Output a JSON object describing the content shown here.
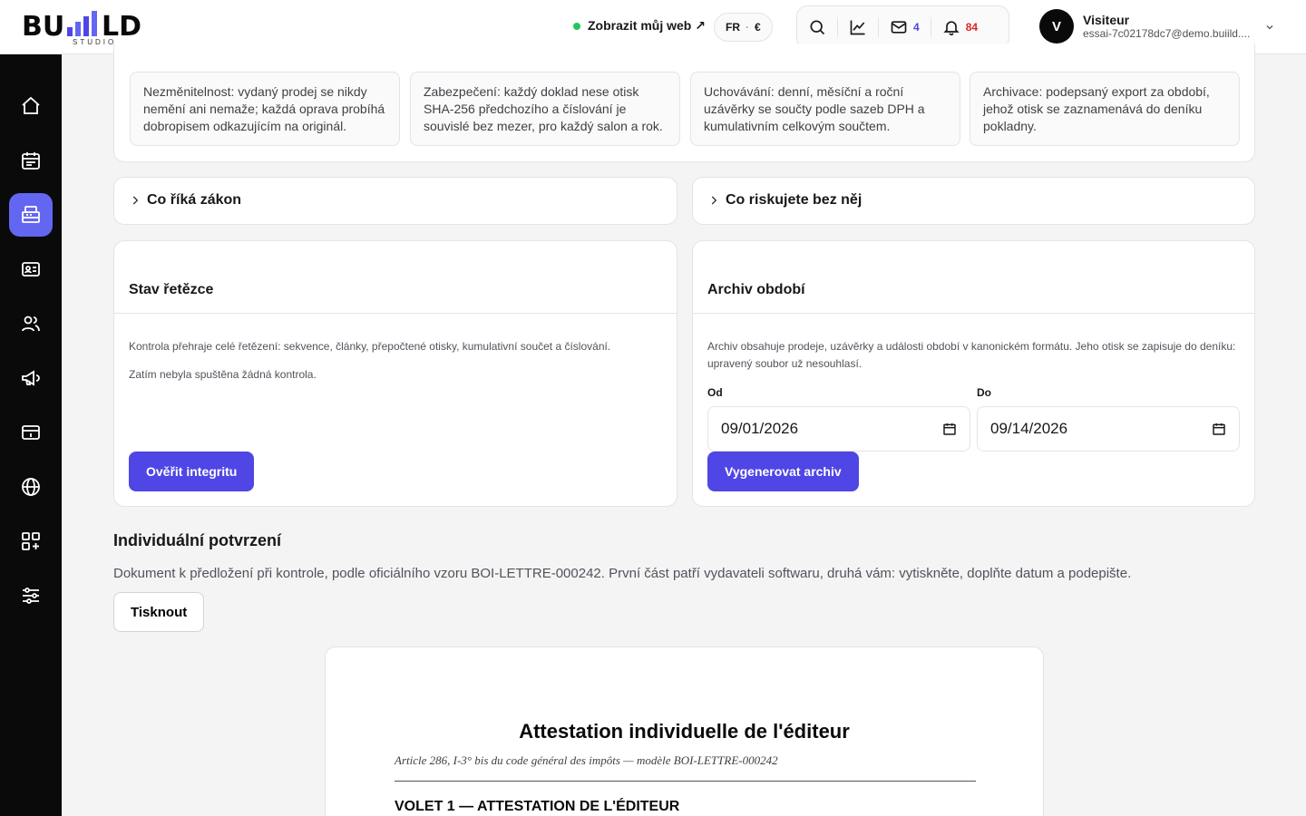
{
  "header": {
    "logo_text": "BUILD",
    "logo_sub": "STUDIO",
    "view_site_label": "Zobrazit můj web ↗",
    "lang": "FR",
    "currency": "€",
    "mail_count": "4",
    "notif_count": "84",
    "user": {
      "initial": "V",
      "name": "Visiteur",
      "email": "essai-7c02178dc7@demo.buiild...."
    }
  },
  "sidebar": {
    "items": [
      {
        "icon": "home-icon"
      },
      {
        "icon": "calendar-icon"
      },
      {
        "icon": "cash-register-icon",
        "active": true
      },
      {
        "icon": "contact-card-icon"
      },
      {
        "icon": "users-icon"
      },
      {
        "icon": "megaphone-icon"
      },
      {
        "icon": "payment-card-icon"
      },
      {
        "icon": "globe-icon"
      },
      {
        "icon": "apps-icon"
      },
      {
        "icon": "settings-sliders-icon"
      }
    ]
  },
  "rules": [
    "Nezměnitelnost: vydaný prodej se nikdy nemění ani nemaže; každá oprava probíhá dobropisem odkazujícím na originál.",
    "Zabezpečení: každý doklad nese otisk SHA-256 předchozího a číslování je souvislé bez mezer, pro každý salon a rok.",
    "Uchovávání: denní, měsíční a roční uzávěrky se součty podle sazeb DPH a kumulativním celkovým součtem.",
    "Archivace: podepsaný export za období, jehož otisk se zaznamenává do deníku pokladny."
  ],
  "collapsibles": {
    "law": "Co říká zákon",
    "risk": "Co riskujete bez něj"
  },
  "chain": {
    "title": "Stav řetězce",
    "desc": "Kontrola přehraje celé řetězení: sekvence, články, přepočtené otisky, kumulativní součet a číslování.",
    "status": "Zatím nebyla spuštěna žádná kontrola.",
    "button": "Ověřit integritu"
  },
  "archive": {
    "title": "Archiv období",
    "desc": "Archiv obsahuje prodeje, uzávěrky a události období v kanonickém formátu. Jeho otisk se zapisuje do deníku: upravený soubor už nesouhlasí.",
    "from_label": "Od",
    "from_value": "09/01/2026",
    "to_label": "Do",
    "to_value": "09/14/2026",
    "button": "Vygenerovat archiv"
  },
  "attestation": {
    "title": "Individuální potvrzení",
    "desc": "Dokument k předložení při kontrole, podle oficiálního vzoru BOI-LETTRE-000242. První část patří vydavateli softwaru, druhá vám: vytiskněte, doplňte datum a podepište.",
    "print_button": "Tisknout",
    "doc_title": "Attestation individuelle de l'éditeur",
    "doc_subtitle": "Article 286, I-3° bis du code général des impôts — modèle BOI-LETTRE-000242",
    "doc_section": "VOLET 1 — ATTESTATION DE L'ÉDITEUR"
  },
  "colors": {
    "accent": "#4f46e5",
    "sidebar_active": "#6366f1",
    "status_green": "#22c55e",
    "notif_red": "#dc2626"
  }
}
